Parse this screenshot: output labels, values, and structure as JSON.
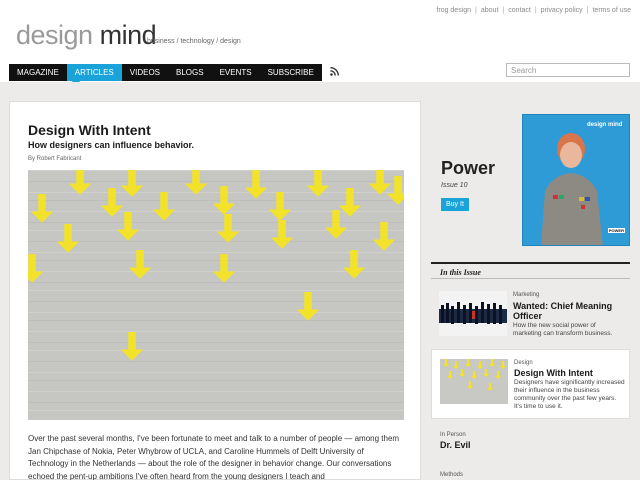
{
  "top_links": [
    "frog design",
    "about",
    "contact",
    "privacy policy",
    "terms of use"
  ],
  "logo": {
    "part1": "design",
    "part2": "mind"
  },
  "tagline": "business / technology / design",
  "nav": {
    "items": [
      "MAGAZINE",
      "ARTICLES",
      "VIDEOS",
      "BLOGS",
      "EVENTS",
      "SUBSCRIBE"
    ],
    "active": "ARTICLES"
  },
  "search": {
    "placeholder": "Search",
    "value": ""
  },
  "article": {
    "title": "Design With Intent",
    "subtitle": "How designers can influence behavior.",
    "byline": "By Robert Fabricant",
    "body": "Over the past several months, I've been fortunate to meet and talk to a number of people — among them Jan Chipchase of Nokia, Peter Whybrow of UCLA, and Caroline Hummels of Delft University of Technology in the Netherlands — about the role of the designer in behavior change. Our conversations echoed the pent-up ambitions I've often heard from the young designers I teach and"
  },
  "issue": {
    "title": "Power",
    "number": "Issue 10",
    "buy_label": "Buy It",
    "cover_title": "design mind",
    "cover_word": "POWER"
  },
  "in_this_issue": {
    "heading": "In this Issue",
    "items": [
      {
        "category": "Marketing",
        "title": "Wanted: Chief Meaning Officer",
        "desc": "How the new social power of marketing can transform business."
      },
      {
        "category": "Design",
        "title": "Design With Intent",
        "desc": "Designers have significantly increased their influence in the business community over the past few years. It's time to use it."
      },
      {
        "category": "In Person",
        "title": "Dr. Evil"
      },
      {
        "category": "Methods"
      }
    ]
  },
  "colors": {
    "accent": "#1aa3d8",
    "nav_bg": "#111111",
    "arrow": "#f2e22a",
    "page_bg": "#ecebe9"
  }
}
